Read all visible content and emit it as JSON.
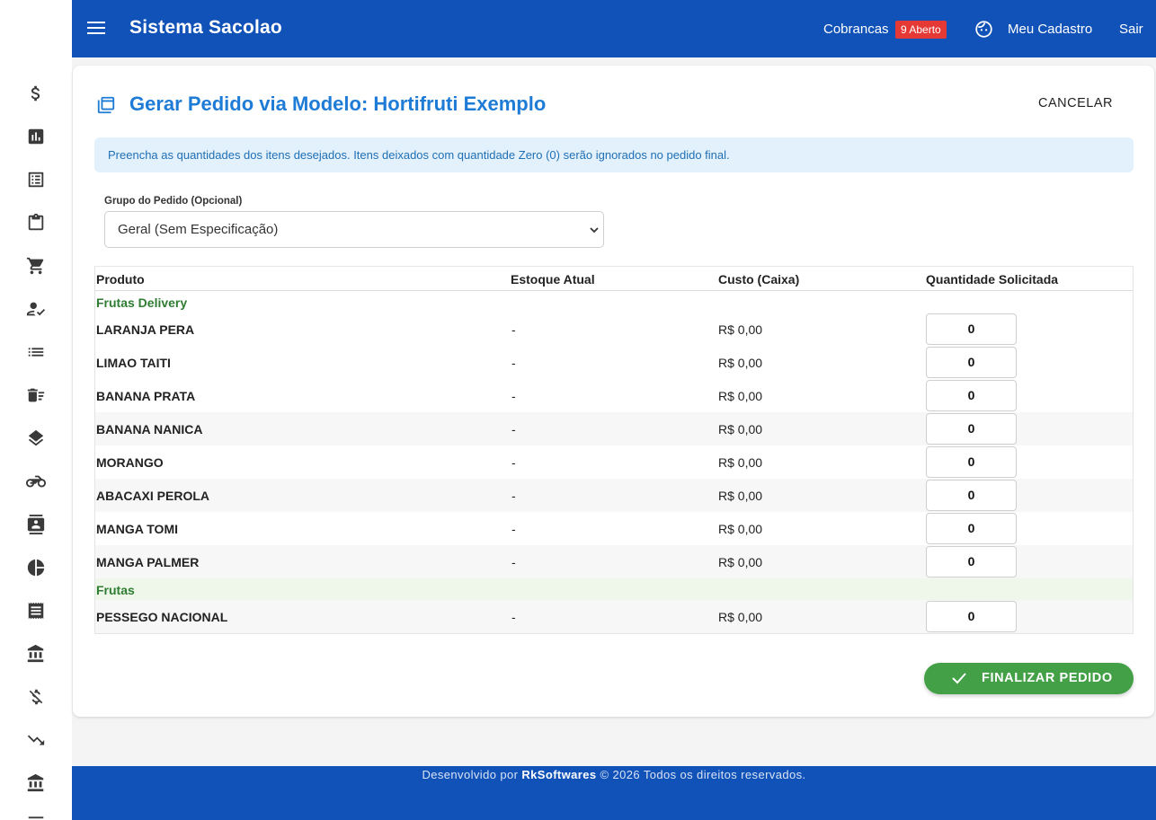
{
  "app": {
    "title": "Sistema Sacolao"
  },
  "topbar": {
    "cobrancas_label": "Cobrancas",
    "cobrancas_badge": "9 Aberto",
    "profile_label": "Meu Cadastro",
    "logout_label": "Sair"
  },
  "sidebar": {
    "icons": [
      "dollar-icon",
      "bar-chart-icon",
      "receipt-list-icon",
      "clipboard-icon",
      "shopping-cart-icon",
      "user-check-icon",
      "list-icon",
      "delete-sweep-icon",
      "layers-icon",
      "motorcycle-icon",
      "contact-card-icon",
      "pie-chart-icon",
      "receipt-icon",
      "bank-icon",
      "money-off-icon",
      "trending-down-icon",
      "bank-icon-2"
    ]
  },
  "page": {
    "title": "Gerar Pedido via Modelo: Hortifruti Exemplo",
    "cancel_label": "CANCELAR",
    "info_text": "Preencha as quantidades dos itens desejados. Itens deixados com quantidade Zero (0) serão ignorados no pedido final.",
    "group_label": "Grupo do Pedido (Opcional)",
    "group_selected": "Geral (Sem Especificação)",
    "submit_label": "FINALIZAR PEDIDO"
  },
  "table": {
    "headers": {
      "produto": "Produto",
      "estoque": "Estoque Atual",
      "custo": "Custo (Caixa)",
      "quantidade": "Quantidade Solicitada"
    },
    "groups": [
      {
        "name": "Frutas Delivery",
        "items": [
          {
            "name": "LARANJA PERA",
            "stock": "-",
            "cost": "R$ 0,00",
            "qty": "0"
          },
          {
            "name": "LIMAO TAITI",
            "stock": "-",
            "cost": "R$ 0,00",
            "qty": "0"
          },
          {
            "name": "BANANA PRATA",
            "stock": "-",
            "cost": "R$ 0,00",
            "qty": "0"
          },
          {
            "name": "BANANA NANICA",
            "stock": "-",
            "cost": "R$ 0,00",
            "qty": "0"
          },
          {
            "name": "MORANGO",
            "stock": "-",
            "cost": "R$ 0,00",
            "qty": "0"
          },
          {
            "name": "ABACAXI PEROLA",
            "stock": "-",
            "cost": "R$ 0,00",
            "qty": "0"
          },
          {
            "name": "MANGA TOMI",
            "stock": "-",
            "cost": "R$ 0,00",
            "qty": "0"
          },
          {
            "name": "MANGA PALMER",
            "stock": "-",
            "cost": "R$ 0,00",
            "qty": "0"
          }
        ]
      },
      {
        "name": "Frutas",
        "items": [
          {
            "name": "PESSEGO NACIONAL",
            "stock": "-",
            "cost": "R$ 0,00",
            "qty": "0"
          }
        ]
      }
    ]
  },
  "footer": {
    "prefix": "Desenvolvido por",
    "company": "RkSoftwares",
    "suffix": "© 2026 Todos os direitos reservados."
  },
  "colors": {
    "primary": "#1152b8",
    "title_blue": "#1e7bd6",
    "badge_red": "#e53935",
    "group_green": "#2e7d32",
    "submit_green": "#43a047"
  }
}
